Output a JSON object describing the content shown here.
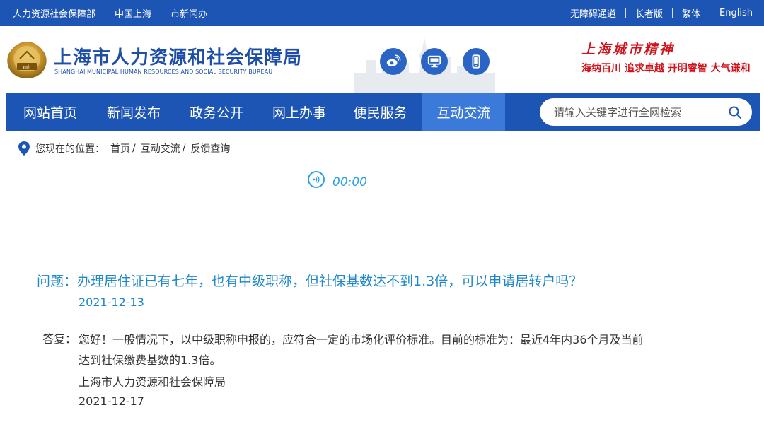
{
  "topbar": {
    "left_links": [
      "人力资源社会保障部",
      "中国上海",
      "市新闻办"
    ],
    "right_links": [
      "无障碍通道",
      "长者版",
      "繁体",
      "English"
    ]
  },
  "header": {
    "title": "上海市人力资源和社会保障局",
    "subtitle": "SHANGHAI MUNICIPAL HUMAN RESOURCES AND SOCIAL SECURITY BUREAU",
    "social_icons": [
      "weibo-icon",
      "desktop-icon",
      "mobile-icon"
    ],
    "spirit_title": "上海城市精神",
    "spirit_line": "海纳百川  追求卓越  开明睿智  大气谦和"
  },
  "nav": {
    "items": [
      "网站首页",
      "新闻发布",
      "政务公开",
      "网上办事",
      "便民服务",
      "互动交流"
    ],
    "active": "互动交流",
    "search_placeholder": "请输入关键字进行全网检索"
  },
  "breadcrumb": {
    "label": "您现在的位置：",
    "items": [
      "首页",
      "互动交流",
      "反馈查询"
    ]
  },
  "audio": {
    "time": "00:00"
  },
  "qa": {
    "question": "问题：办理居住证已有七年，也有中级职称，但社保基数达不到1.3倍，可以申请居转户吗？",
    "question_date": "2021-12-13",
    "answer_label": "答复：",
    "answer_line1": "您好！一般情况下，以中级职称申报的，应符合一定的市场化评价标准。目前的标准为：最近4年内36个月及当前",
    "answer_line2": "达到社保缴费基数的1.3倍。",
    "answer_org": "上海市人力资源和社会保障局",
    "answer_date": "2021-12-17"
  },
  "colors": {
    "brand_blue": "#1d55b4",
    "nav_active": "#3b7ad8",
    "link_blue": "#1e87c9",
    "spirit_red": "#d0121b"
  }
}
